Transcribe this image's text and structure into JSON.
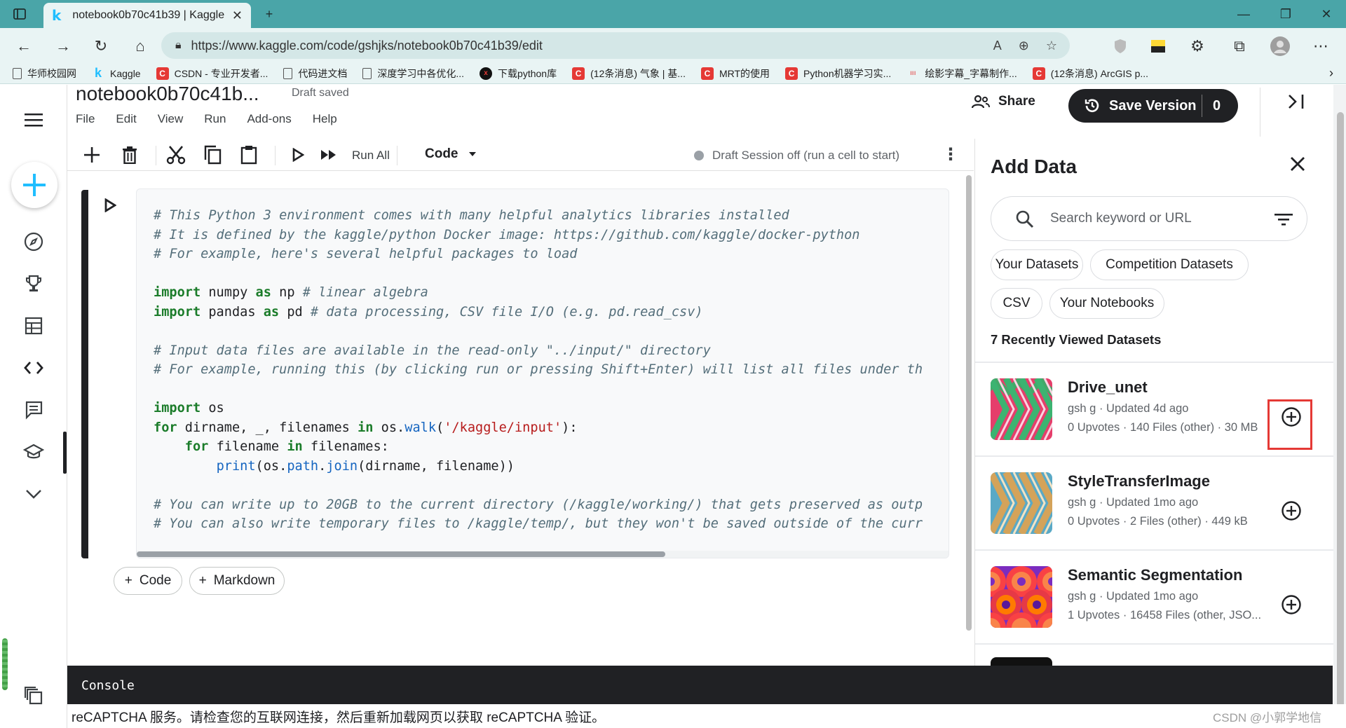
{
  "browser": {
    "tab_title": "notebook0b70c41b39 | Kaggle",
    "url": "https://www.kaggle.com/code/gshjks/notebook0b70c41b39/edit",
    "bookmarks": [
      {
        "label": "华师校园网",
        "icon": "doc"
      },
      {
        "label": "Kaggle",
        "icon": "k"
      },
      {
        "label": "CSDN - 专业开发者...",
        "icon": "c"
      },
      {
        "label": "代码进文档",
        "icon": "doc"
      },
      {
        "label": "深度学习中各优化...",
        "icon": "doc"
      },
      {
        "label": "下载python库",
        "icon": "x"
      },
      {
        "label": "(12条消息) 气象 | 基...",
        "icon": "c"
      },
      {
        "label": "MRT的使用",
        "icon": "c"
      },
      {
        "label": "Python机器学习实...",
        "icon": "c"
      },
      {
        "label": "绘影字幕_字幕制作...",
        "icon": "dots"
      },
      {
        "label": "(12条消息) ArcGIS p...",
        "icon": "c"
      }
    ]
  },
  "notebook": {
    "title": "notebook0b70c41b...",
    "save_status": "Draft saved",
    "menu": [
      "File",
      "Edit",
      "View",
      "Run",
      "Add-ons",
      "Help"
    ],
    "share_label": "Share",
    "save_version_label": "Save Version",
    "save_version_count": "0"
  },
  "toolbar": {
    "run_all_label": "Run All",
    "cell_type": "Code",
    "session_status": "Draft Session off (run a cell to start)"
  },
  "code_lines": [
    [
      [
        "cmt",
        "# This Python 3 environment comes with many helpful analytics libraries installed"
      ]
    ],
    [
      [
        "cmt",
        "# It is defined by the kaggle/python Docker image: https://github.com/kaggle/docker-python"
      ]
    ],
    [
      [
        "cmt",
        "# For example, here's several helpful packages to load"
      ]
    ],
    [],
    [
      [
        "kw",
        "import"
      ],
      [
        "",
        " numpy "
      ],
      [
        "kw",
        "as"
      ],
      [
        "",
        " np "
      ],
      [
        "cmt",
        "# linear algebra"
      ]
    ],
    [
      [
        "kw",
        "import"
      ],
      [
        "",
        " pandas "
      ],
      [
        "kw",
        "as"
      ],
      [
        "",
        " pd "
      ],
      [
        "cmt",
        "# data processing, CSV file I/O (e.g. pd.read_csv)"
      ]
    ],
    [],
    [
      [
        "cmt",
        "# Input data files are available in the read-only \"../input/\" directory"
      ]
    ],
    [
      [
        "cmt",
        "# For example, running this (by clicking run or pressing Shift+Enter) will list all files under th"
      ]
    ],
    [],
    [
      [
        "kw",
        "import"
      ],
      [
        "",
        " os"
      ]
    ],
    [
      [
        "kw",
        "for"
      ],
      [
        "",
        " dirname, _, filenames "
      ],
      [
        "kw",
        "in"
      ],
      [
        "",
        " os."
      ],
      [
        "fn",
        "walk"
      ],
      [
        "",
        "("
      ],
      [
        "str",
        "'/kaggle/input'"
      ],
      [
        "",
        "):"
      ]
    ],
    [
      [
        "",
        "    "
      ],
      [
        "kw",
        "for"
      ],
      [
        "",
        " filename "
      ],
      [
        "kw",
        "in"
      ],
      [
        "",
        " filenames:"
      ]
    ],
    [
      [
        "",
        "        "
      ],
      [
        "fn",
        "print"
      ],
      [
        "",
        "(os."
      ],
      [
        "fn",
        "path"
      ],
      [
        "",
        "."
      ],
      [
        "fn",
        "join"
      ],
      [
        "",
        "(dirname, filename))"
      ]
    ],
    [],
    [
      [
        "cmt",
        "# You can write up to 20GB to the current directory (/kaggle/working/) that gets preserved as outp"
      ]
    ],
    [
      [
        "cmt",
        "# You can also write temporary files to /kaggle/temp/, but they won't be saved outside of the curr"
      ]
    ]
  ],
  "add_cell": {
    "code_label": "Code",
    "markdown_label": "Markdown"
  },
  "panel": {
    "title": "Add Data",
    "search_placeholder": "Search keyword or URL",
    "chips": [
      "Your Datasets",
      "Competition Datasets",
      "CSV",
      "Your Notebooks"
    ],
    "recent_label": "7 Recently Viewed Datasets",
    "datasets": [
      {
        "name": "Drive_unet",
        "meta": "gsh g · Updated 4d ago",
        "stats": "0 Upvotes · 140 Files (other) · 30 MB"
      },
      {
        "name": "StyleTransferImage",
        "meta": "gsh g · Updated 1mo ago",
        "stats": "0 Upvotes · 2 Files (other) · 449 kB"
      },
      {
        "name": "Semantic Segmentation",
        "meta": "gsh g · Updated 1mo ago",
        "stats": "1 Upvotes · 16458 Files (other, JSO..."
      }
    ]
  },
  "console": {
    "label": "Console",
    "message": "reCAPTCHA 服务。请检查您的互联网连接，然后重新加载网页以获取 reCAPTCHA 验证。"
  },
  "watermark": "CSDN @小郭学地信",
  "colors": {
    "browser_teal": "#4aa5a8",
    "kaggle_blue": "#20beff",
    "dark": "#202124",
    "highlight_red": "#e53935"
  }
}
